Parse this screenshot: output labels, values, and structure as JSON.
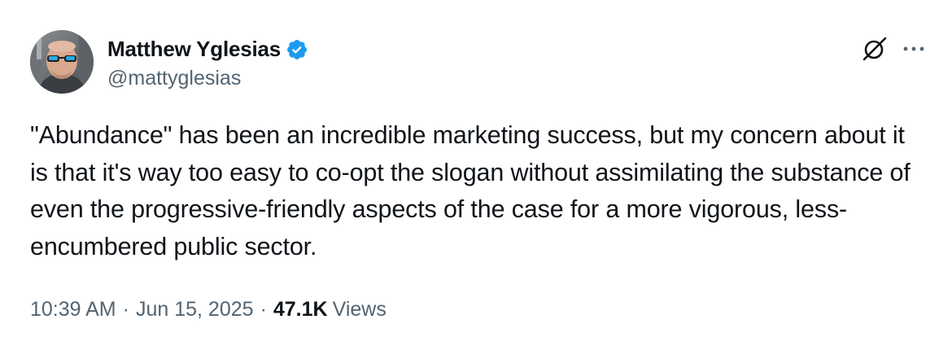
{
  "author": {
    "display_name": "Matthew Yglesias",
    "handle": "@mattyglesias",
    "verified_icon": "verified-badge-icon",
    "verified_color": "#1d9bf0"
  },
  "tweet": {
    "text": "\"Abundance\" has been an incredible marketing success, but my concern about it is that it's way too easy to co-opt the slogan without assimilating the substance of even the progressive-friendly aspects of the case for a more vigorous, less-encumbered public sector."
  },
  "meta": {
    "time": "10:39 AM",
    "separator": "·",
    "date": "Jun 15, 2025",
    "views_count": "47.1K",
    "views_label": "Views"
  },
  "actions": {
    "grok_icon": "grok-icon",
    "more_icon": "more-icon"
  },
  "colors": {
    "primary_text": "#0f1419",
    "secondary_text": "#536471",
    "accent": "#1d9bf0"
  }
}
